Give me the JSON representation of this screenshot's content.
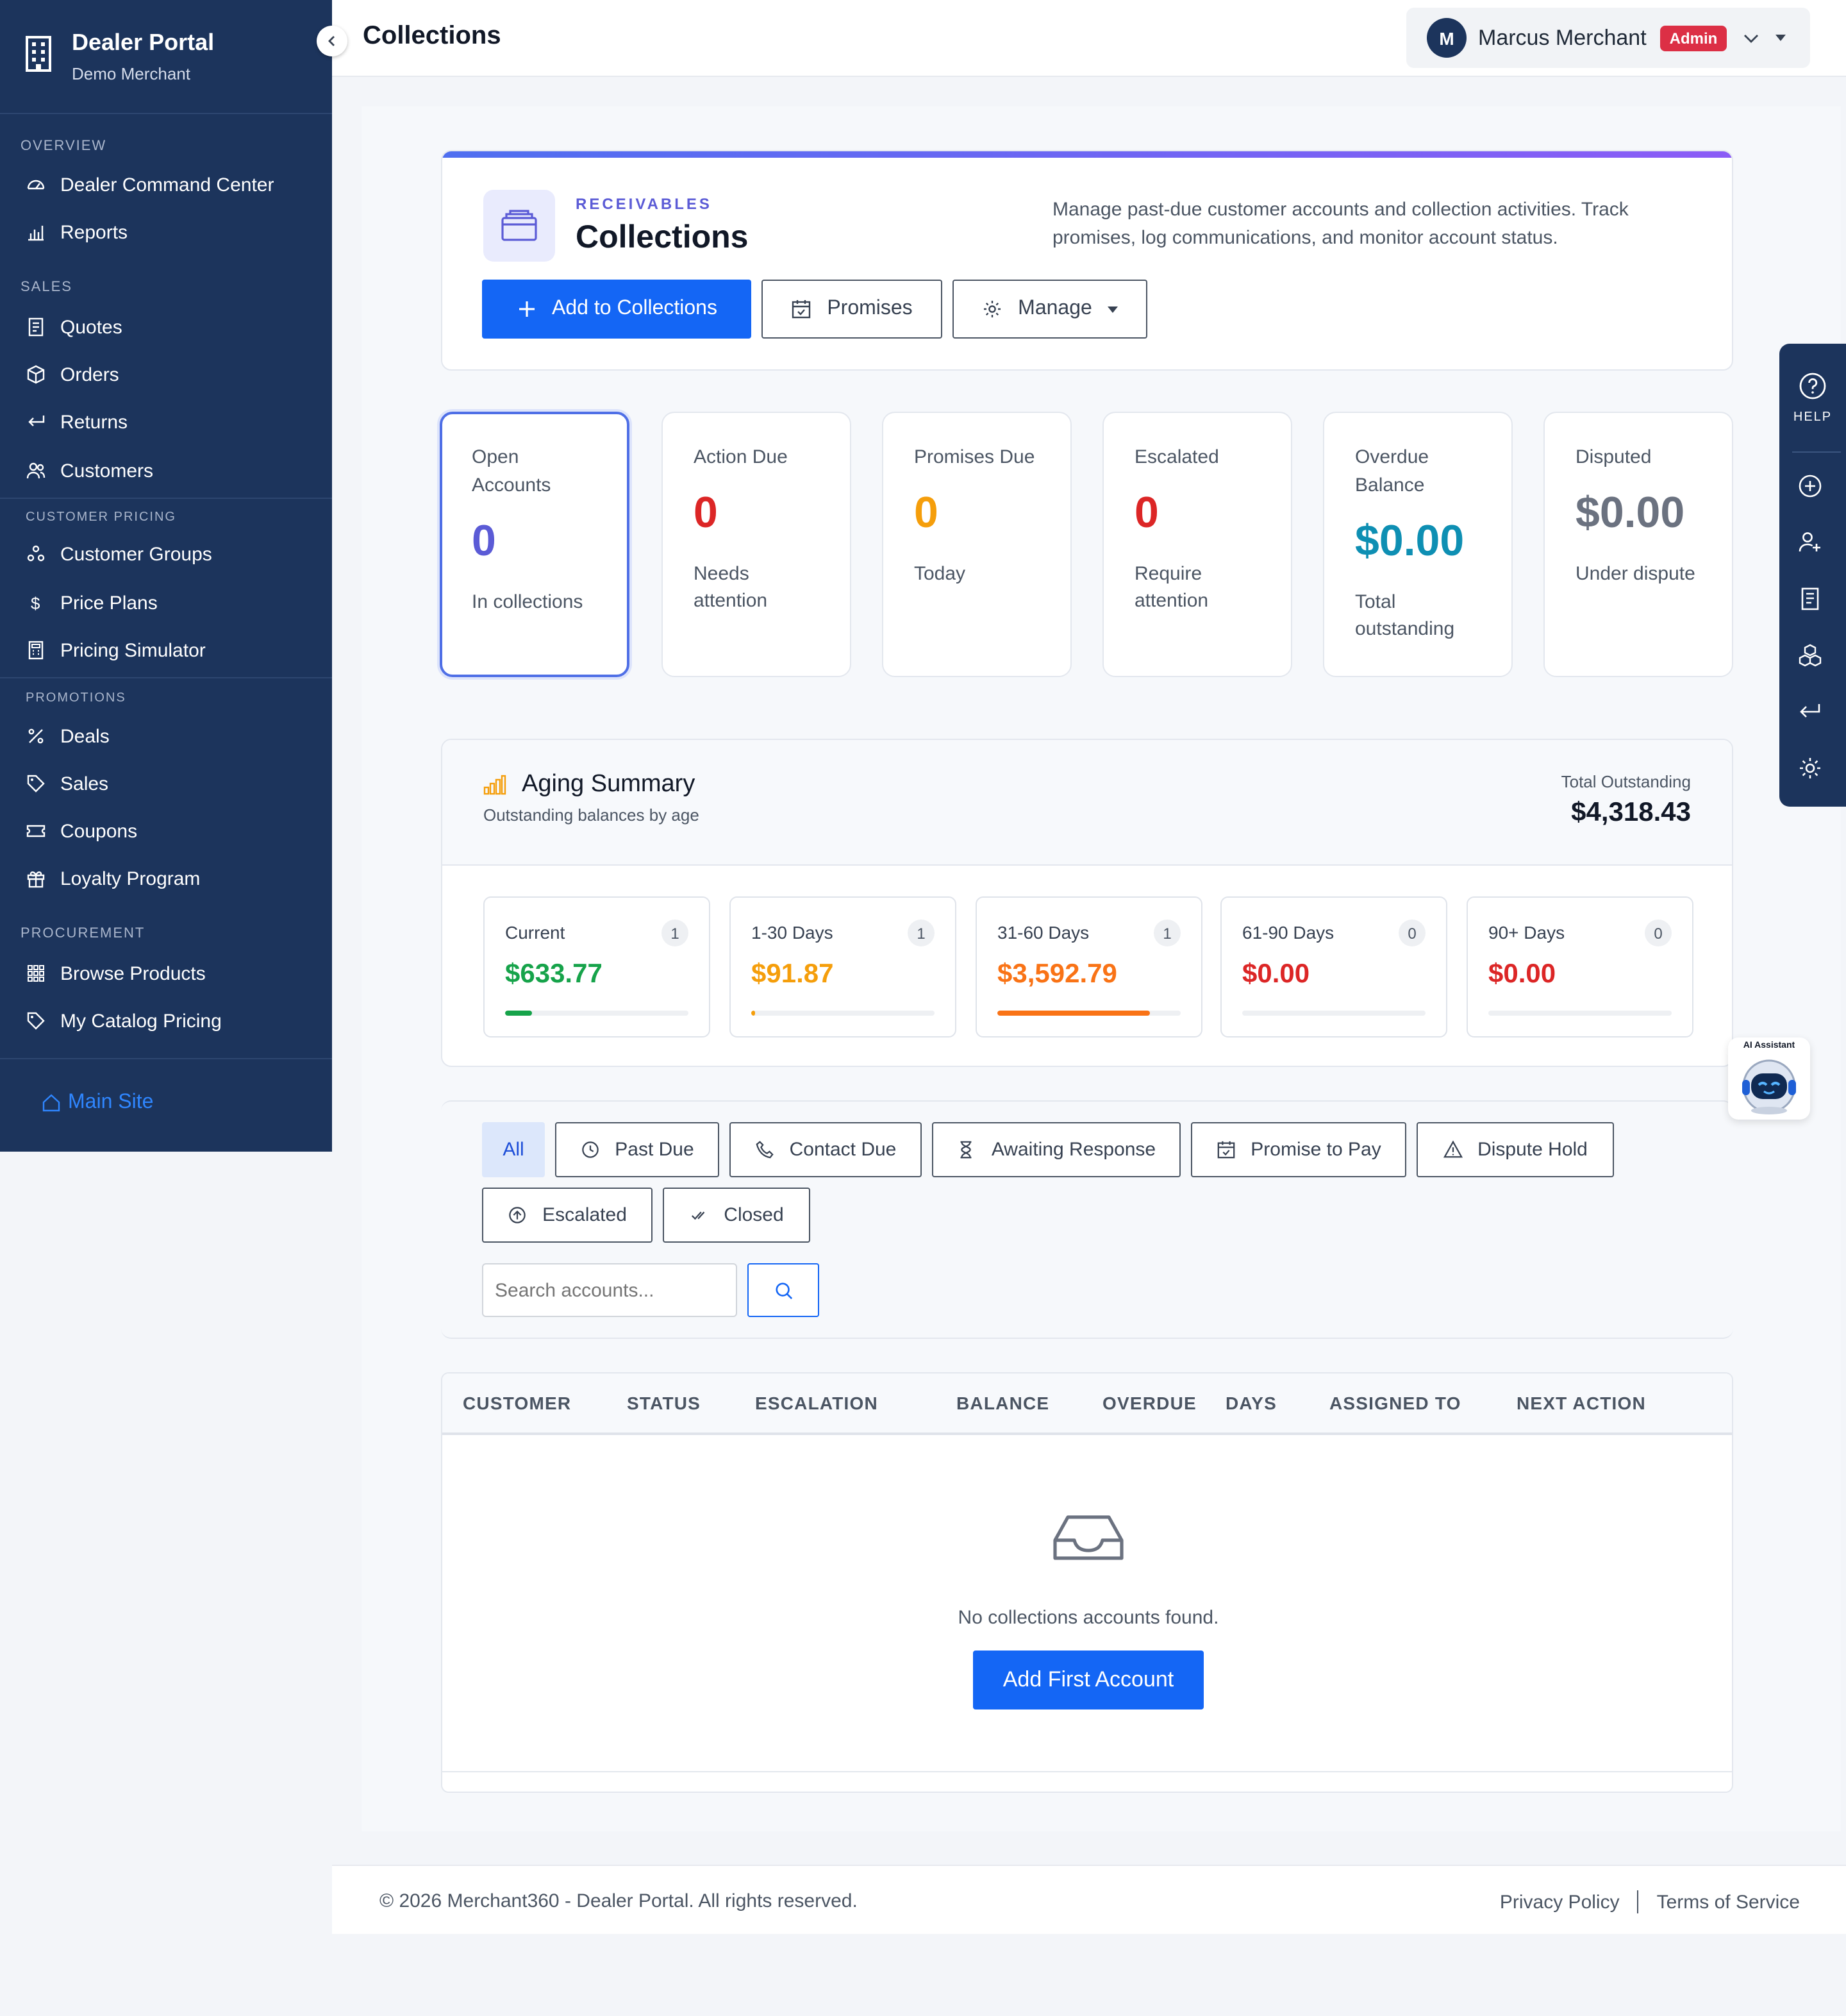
{
  "sidebar": {
    "brand_title": "Dealer Portal",
    "brand_sub": "Demo Merchant",
    "sections": {
      "overview": "OVERVIEW",
      "sales": "SALES",
      "customer_pricing": "CUSTOMER PRICING",
      "promotions": "PROMOTIONS",
      "procurement": "PROCUREMENT"
    },
    "items": {
      "dealer_command_center": "Dealer Command Center",
      "reports": "Reports",
      "quotes": "Quotes",
      "orders": "Orders",
      "returns": "Returns",
      "customers": "Customers",
      "customer_groups": "Customer Groups",
      "price_plans": "Price Plans",
      "pricing_simulator": "Pricing Simulator",
      "deals": "Deals",
      "sales": "Sales",
      "coupons": "Coupons",
      "loyalty_program": "Loyalty Program",
      "browse_products": "Browse Products",
      "my_catalog_pricing": "My Catalog Pricing"
    },
    "main_site": "Main Site"
  },
  "topbar": {
    "title": "Collections",
    "user_initial": "M",
    "user_name": "Marcus Merchant",
    "role_badge": "Admin"
  },
  "hero": {
    "eyebrow": "RECEIVABLES",
    "title": "Collections",
    "description": "Manage past-due customer accounts and collection activities. Track promises, log communications, and monitor account status.",
    "add_button": "Add to Collections",
    "promises_button": "Promises",
    "manage_button": "Manage"
  },
  "stats": {
    "open": {
      "label": "Open Accounts",
      "value": "0",
      "sub": "In collections",
      "color": "#5b5bd6"
    },
    "action": {
      "label": "Action Due",
      "value": "0",
      "sub": "Needs attention",
      "color": "#dc2626"
    },
    "promises": {
      "label": "Promises Due",
      "value": "0",
      "sub": "Today",
      "color": "#f59e0b"
    },
    "escalated": {
      "label": "Escalated",
      "value": "0",
      "sub": "Require attention",
      "color": "#dc2626"
    },
    "overdue": {
      "label": "Overdue Balance",
      "value": "$0.00",
      "sub": "Total outstanding",
      "color": "#0e8fb3"
    },
    "disputed": {
      "label": "Disputed",
      "value": "$0.00",
      "sub": "Under dispute",
      "color": "#6b7280"
    }
  },
  "aging": {
    "title": "Aging Summary",
    "subtitle": "Outstanding balances by age",
    "total_label": "Total Outstanding",
    "total_value": "$4,318.43",
    "buckets": [
      {
        "label": "Current",
        "count": "1",
        "amount": "$633.77",
        "color": "#16a34a",
        "fill": 0.147
      },
      {
        "label": "1-30 Days",
        "count": "1",
        "amount": "$91.87",
        "color": "#f59e0b",
        "fill": 0.021
      },
      {
        "label": "31-60 Days",
        "count": "1",
        "amount": "$3,592.79",
        "color": "#f97316",
        "fill": 0.832
      },
      {
        "label": "61-90 Days",
        "count": "0",
        "amount": "$0.00",
        "color": "#dc2626",
        "fill": 0
      },
      {
        "label": "90+ Days",
        "count": "0",
        "amount": "$0.00",
        "color": "#dc2626",
        "fill": 0
      }
    ]
  },
  "filters": {
    "all": "All",
    "past_due": "Past Due",
    "contact_due": "Contact Due",
    "awaiting_response": "Awaiting Response",
    "promise_to_pay": "Promise to Pay",
    "dispute_hold": "Dispute Hold",
    "escalated": "Escalated",
    "closed": "Closed",
    "search_placeholder": "Search accounts..."
  },
  "table": {
    "columns": [
      "CUSTOMER",
      "STATUS",
      "ESCALATION",
      "BALANCE",
      "OVERDUE",
      "DAYS",
      "ASSIGNED TO",
      "NEXT ACTION"
    ],
    "empty_text": "No collections accounts found.",
    "empty_button": "Add First Account"
  },
  "footer": {
    "copyright": "© 2026 Merchant360 - Dealer Portal. All rights reserved.",
    "privacy": "Privacy Policy",
    "terms": "Terms of Service"
  },
  "rail": {
    "help": "HELP"
  },
  "assistant": {
    "label": "AI Assistant"
  }
}
